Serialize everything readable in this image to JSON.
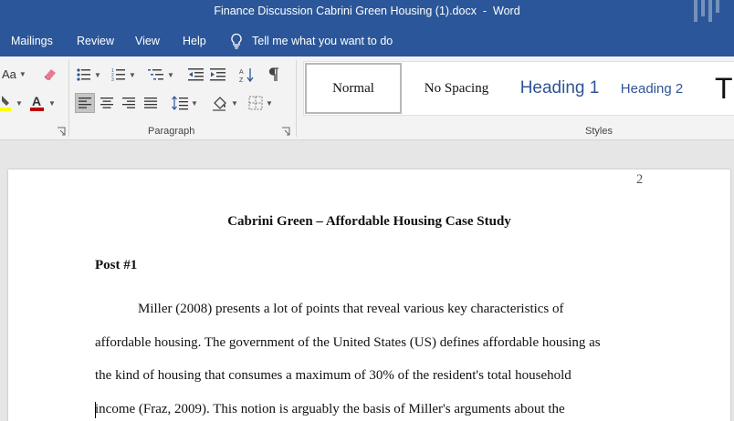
{
  "window": {
    "title": "Finance Discussion Cabrini Green Housing (1).docx  -  Word"
  },
  "menu": {
    "tabs": [
      "Mailings",
      "Review",
      "View",
      "Help"
    ],
    "tell_me": "Tell me what you want to do"
  },
  "ribbon": {
    "font_case_label": "Aa",
    "paragraph_group_label": "Paragraph",
    "styles_group_label": "Styles",
    "styles": {
      "normal": "Normal",
      "no_spacing": "No Spacing",
      "heading1": "Heading 1",
      "heading2": "Heading 2",
      "title_preview": "T"
    },
    "icons": [
      "change-case-icon",
      "clear-formatting-icon",
      "bullets-icon",
      "numbering-icon",
      "multilevel-list-icon",
      "decrease-indent-icon",
      "increase-indent-icon",
      "sort-icon",
      "show-formatting-marks-icon",
      "highlight-icon",
      "font-color-icon",
      "align-left-icon",
      "align-center-icon",
      "align-right-icon",
      "justify-icon",
      "line-spacing-icon",
      "shading-icon",
      "borders-icon"
    ],
    "colors": {
      "highlight": "#ffff00",
      "font_color": "#c00000"
    }
  },
  "document": {
    "page_number": "2",
    "title": "Cabrini Green – Affordable Housing Case Study",
    "post_heading": "Post #1",
    "lines": [
      "Miller (2008) presents a lot of points that reveal various key characteristics of",
      "affordable housing. The government of the United States (US) defines affordable housing as",
      "the kind of housing that consumes a maximum of 30% of the resident's total household",
      "income (Fraz, 2009). This notion is arguably the basis of Miller's arguments about the"
    ]
  },
  "theme": {
    "accent": "#2b579a",
    "heading_color": "#2f5496"
  }
}
